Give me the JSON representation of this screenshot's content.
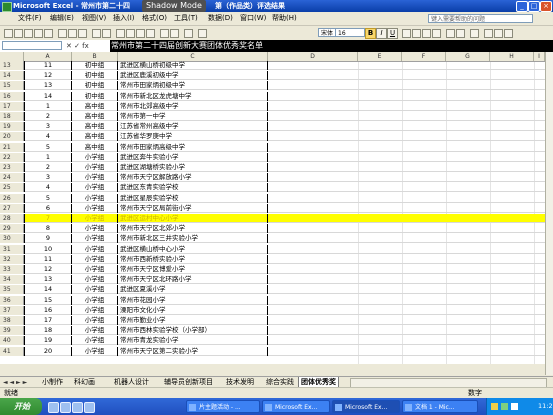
{
  "window": {
    "title": "Microsoft Excel - 常州市第二十四",
    "overlay": "Shadow Mode",
    "title_suffix": "第（作品类）评选结果",
    "buttons": [
      "_",
      "□",
      "×"
    ]
  },
  "menu": {
    "items": [
      "文件(F)",
      "编辑(E)",
      "视图(V)",
      "插入(I)",
      "格式(O)",
      "工具(T)",
      "数据(D)",
      "窗口(W)",
      "帮助(H)"
    ],
    "help_placeholder": "键入需要帮助的问题"
  },
  "toolbar": {
    "font_name": "宋体",
    "font_size": "16",
    "bold": "B",
    "italic": "I",
    "underline": "U"
  },
  "formula_bar": {
    "name_box": "",
    "fx": "✕ ✓ fx",
    "content": "常州市第二十四届创新大赛团体优秀奖名单"
  },
  "columns": [
    "A",
    "B",
    "C",
    "D",
    "E",
    "F",
    "G",
    "H",
    "I",
    "J"
  ],
  "rows": [
    {
      "n": "13",
      "a": "11",
      "b": "初中组",
      "c": "武进区横山桥初级中学"
    },
    {
      "n": "14",
      "a": "12",
      "b": "初中组",
      "c": "武进区鹿溪初级中学"
    },
    {
      "n": "15",
      "a": "13",
      "b": "初中组",
      "c": "常州市田家炳初级中学"
    },
    {
      "n": "16",
      "a": "14",
      "b": "初中组",
      "c": "常州市新北区龙虎塘中学"
    },
    {
      "n": "17",
      "a": "1",
      "b": "高中组",
      "c": "常州市北郊高级中学"
    },
    {
      "n": "18",
      "a": "2",
      "b": "高中组",
      "c": "常州市第一中学"
    },
    {
      "n": "19",
      "a": "3",
      "b": "高中组",
      "c": "江苏省常州高级中学"
    },
    {
      "n": "20",
      "a": "4",
      "b": "高中组",
      "c": "江苏省华罗庚中学"
    },
    {
      "n": "21",
      "a": "5",
      "b": "高中组",
      "c": "常州市田家炳高级中学"
    },
    {
      "n": "22",
      "a": "1",
      "b": "小学组",
      "c": "武进区奔牛实验小学"
    },
    {
      "n": "23",
      "a": "2",
      "b": "小学组",
      "c": "武进区湖塘桥实验小学"
    },
    {
      "n": "24",
      "a": "3",
      "b": "小学组",
      "c": "常州市天宁区解放路小学"
    },
    {
      "n": "25",
      "a": "4",
      "b": "小学组",
      "c": "武进区东青实验学校"
    },
    {
      "n": "26",
      "a": "5",
      "b": "小学组",
      "c": "武进区星辰实验学校"
    },
    {
      "n": "27",
      "a": "6",
      "b": "小学组",
      "c": "常州市天宁区局前街小学"
    },
    {
      "n": "28",
      "a": "7",
      "b": "小学组",
      "c": "武进区运村中心小学",
      "highlight": true
    },
    {
      "n": "29",
      "a": "8",
      "b": "小学组",
      "c": "常州市天宁区北郊小学"
    },
    {
      "n": "30",
      "a": "9",
      "b": "小学组",
      "c": "常州市新北区三井实验小学"
    },
    {
      "n": "31",
      "a": "10",
      "b": "小学组",
      "c": "武进区横山桥中心小学"
    },
    {
      "n": "32",
      "a": "11",
      "b": "小学组",
      "c": "常州市西新桥实验小学"
    },
    {
      "n": "33",
      "a": "12",
      "b": "小学组",
      "c": "常州市天宁区博爱小学"
    },
    {
      "n": "34",
      "a": "13",
      "b": "小学组",
      "c": "常州市天宁区北环路小学"
    },
    {
      "n": "35",
      "a": "14",
      "b": "小学组",
      "c": "武进区夏溪小学"
    },
    {
      "n": "36",
      "a": "15",
      "b": "小学组",
      "c": "常州市花园小学"
    },
    {
      "n": "37",
      "a": "16",
      "b": "小学组",
      "c": "溧阳市文化小学"
    },
    {
      "n": "38",
      "a": "17",
      "b": "小学组",
      "c": "常州市勤业小学"
    },
    {
      "n": "39",
      "a": "18",
      "b": "小学组",
      "c": "常州市西林实验学校（小学部）"
    },
    {
      "n": "40",
      "a": "19",
      "b": "小学组",
      "c": "常州市青龙实验小学"
    },
    {
      "n": "41",
      "a": "20",
      "b": "小学组",
      "c": "常州市天宁区第二实验小学"
    }
  ],
  "sheet_tabs": {
    "nav": "◄ ◄ ► ►",
    "tabs": [
      "小制作",
      "科幻画",
      "机器人设计",
      "辅导员创新项目",
      "技术发明",
      "综合实践",
      "团体优秀奖"
    ],
    "active": "团体优秀奖"
  },
  "status": {
    "left": "就绪",
    "mode": "数字"
  },
  "taskbar": {
    "start": "开始",
    "tasks": [
      "片主题活动 - ...",
      "Microsoft Ex...",
      "Microsoft Ex...",
      "文档 1 - Mic..."
    ],
    "clock": "11:22"
  }
}
